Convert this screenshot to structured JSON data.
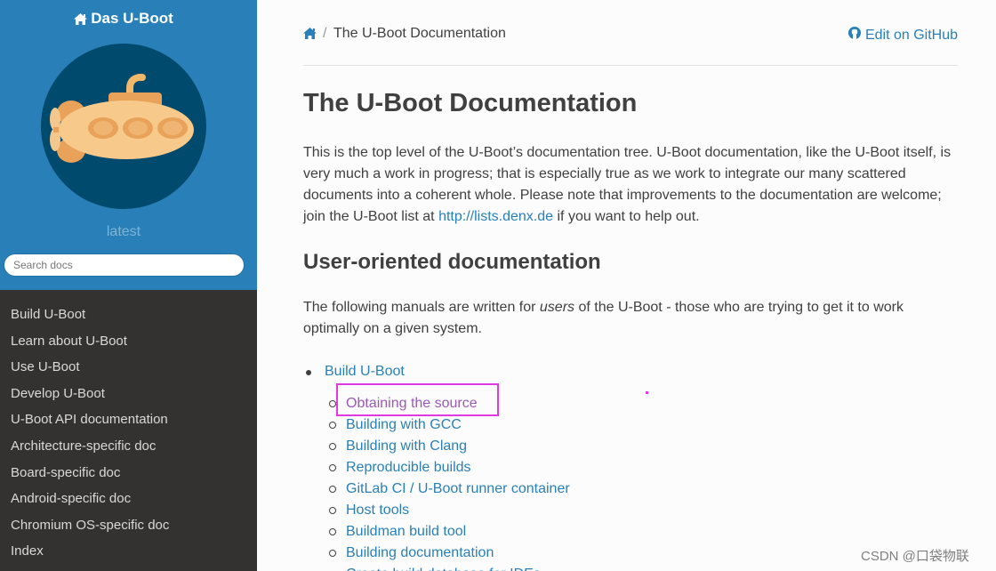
{
  "sidebar": {
    "project_name": "Das U-Boot",
    "version": "latest",
    "search_placeholder": "Search docs",
    "items": [
      {
        "label": "Build U-Boot"
      },
      {
        "label": "Learn about U-Boot"
      },
      {
        "label": "Use U-Boot"
      },
      {
        "label": "Develop U-Boot"
      },
      {
        "label": "U-Boot API documentation"
      },
      {
        "label": "Architecture-specific doc"
      },
      {
        "label": "Board-specific doc"
      },
      {
        "label": "Android-specific doc"
      },
      {
        "label": "Chromium OS-specific doc"
      },
      {
        "label": "Index"
      }
    ]
  },
  "breadcrumb": {
    "separator": "/",
    "current": "The U-Boot Documentation",
    "edit_label": "Edit on GitHub"
  },
  "main": {
    "title": "The U-Boot Documentation",
    "intro_text": "This is the top level of the U-Boot’s documentation tree. U-Boot documentation, like the U-Boot itself, is very much a work in progress; that is especially true as we work to integrate our many scattered documents into a coherent whole. Please note that improvements to the documentation are welcome; join the U-Boot list at ",
    "intro_link": "http://lists.denx.de",
    "intro_tail": " if you want to help out.",
    "section_title": "User-oriented documentation",
    "section_pre": "The following manuals are written for ",
    "section_em": "users",
    "section_post": " of the U-Boot - those who are trying to get it to work optimally on a given system.",
    "toc_top": "Build U-Boot",
    "toc_sub": [
      {
        "label": "Obtaining the source"
      },
      {
        "label": "Building with GCC"
      },
      {
        "label": "Building with Clang"
      },
      {
        "label": "Reproducible builds"
      },
      {
        "label": "GitLab CI / U-Boot runner container"
      },
      {
        "label": "Host tools"
      },
      {
        "label": "Buildman build tool"
      },
      {
        "label": "Building documentation"
      },
      {
        "label": "Create build database for IDEs"
      }
    ]
  },
  "watermark": "CSDN @口袋物联",
  "colors": {
    "sidebar_accent": "#2980b9",
    "sidebar_bg": "#343131",
    "link": "#2980b9",
    "visited_link": "#9b59b6",
    "annotation": "#e23ae2"
  }
}
